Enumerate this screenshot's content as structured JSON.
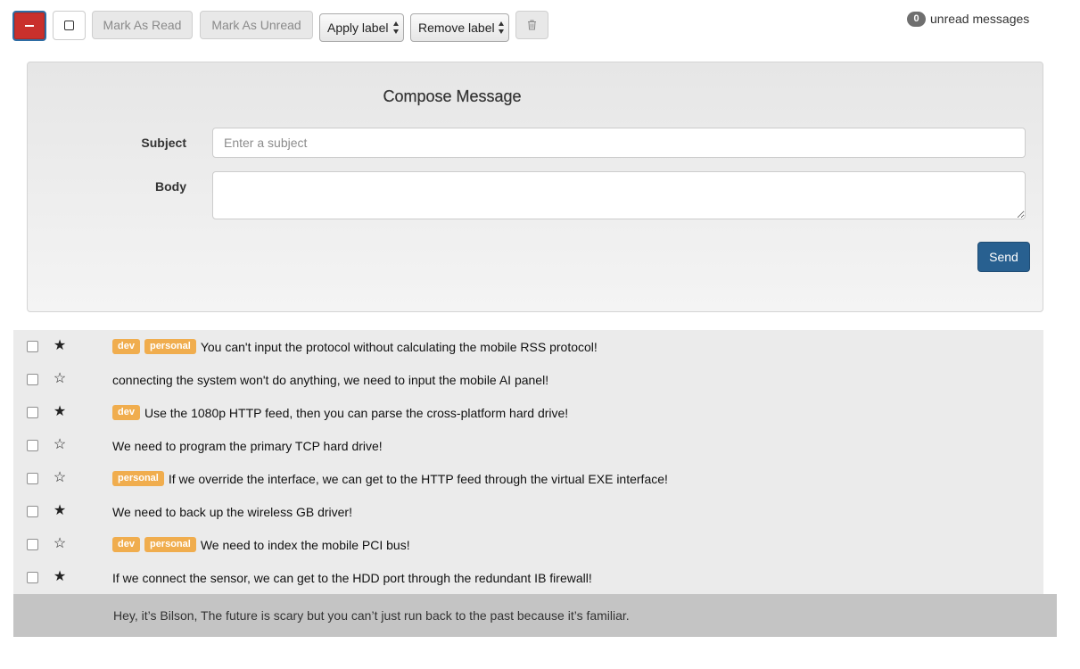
{
  "toolbar": {
    "mark_read_label": "Mark As Read",
    "mark_unread_label": "Mark As Unread",
    "apply_label_selected": "Apply label",
    "remove_label_selected": "Remove label",
    "unread_count": "0",
    "unread_text": "unread messages",
    "toggle_icon": "minus-icon",
    "select_all_icon": "square-icon",
    "delete_icon": "trash-icon"
  },
  "compose": {
    "title": "Compose Message",
    "subject_label": "Subject",
    "subject_placeholder": "Enter a subject",
    "subject_value": "",
    "body_label": "Body",
    "body_value": "",
    "send_label": "Send"
  },
  "messages": [
    {
      "starred": true,
      "labels": [
        "dev",
        "personal"
      ],
      "subject": "You can't input the protocol without calculating the mobile RSS protocol!"
    },
    {
      "starred": false,
      "labels": [],
      "subject": "connecting the system won't do anything, we need to input the mobile AI panel!"
    },
    {
      "starred": true,
      "labels": [
        "dev"
      ],
      "subject": "Use the 1080p HTTP feed, then you can parse the cross-platform hard drive!"
    },
    {
      "starred": false,
      "labels": [],
      "subject": "We need to program the primary TCP hard drive!"
    },
    {
      "starred": false,
      "labels": [
        "personal"
      ],
      "subject": "If we override the interface, we can get to the HTTP feed through the virtual EXE interface!"
    },
    {
      "starred": true,
      "labels": [],
      "subject": "We need to back up the wireless GB driver!"
    },
    {
      "starred": false,
      "labels": [
        "dev",
        "personal"
      ],
      "subject": "We need to index the mobile PCI bus!"
    },
    {
      "starred": true,
      "labels": [],
      "subject": "If we connect the sensor, we can get to the HDD port through the redundant IB firewall!"
    }
  ],
  "footer": {
    "text": "Hey, it’s Bilson, The future is scary but you can’t just run back to the past because it’s familiar."
  },
  "colors": {
    "danger": "#c9302c",
    "primary": "#286090",
    "label_warning": "#f0ad4e",
    "badge": "#6f6f6f"
  }
}
